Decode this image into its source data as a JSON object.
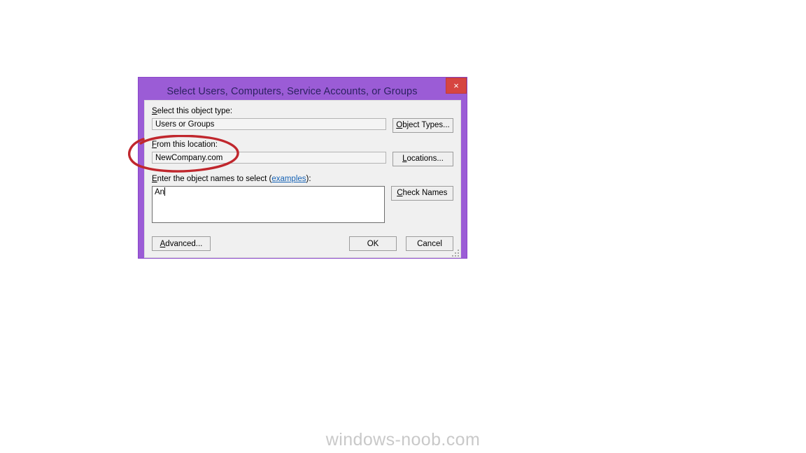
{
  "watermark": "windows-noob.com",
  "dialog": {
    "title": "Select Users, Computers, Service Accounts, or Groups",
    "close_label": "×",
    "colors": {
      "frame_purple": "#9b5cd6",
      "body_gray": "#f0f0f0",
      "close_red": "#d64541",
      "title_text": "#2c2260",
      "link_blue": "#1763b5",
      "annotation_red": "#c0272d"
    },
    "fields": [
      {
        "label_prefix": "S",
        "label_rest": "elect this object type:",
        "value": "Users or Groups",
        "button_prefix": "O",
        "button_rest": "bject Types..."
      },
      {
        "label_prefix": "F",
        "label_rest": "rom this location:",
        "value": "NewCompany.com",
        "button_prefix": "L",
        "button_rest": "ocations..."
      }
    ],
    "names_section": {
      "label_prefix": "E",
      "label_mid": "nter the object names to select (",
      "label_link": "examples",
      "label_suffix": "):",
      "value": "An",
      "button_prefix": "C",
      "button_rest": "heck Names"
    },
    "buttons": {
      "advanced_prefix": "A",
      "advanced_rest": "dvanced...",
      "ok": "OK",
      "cancel": "Cancel"
    }
  }
}
